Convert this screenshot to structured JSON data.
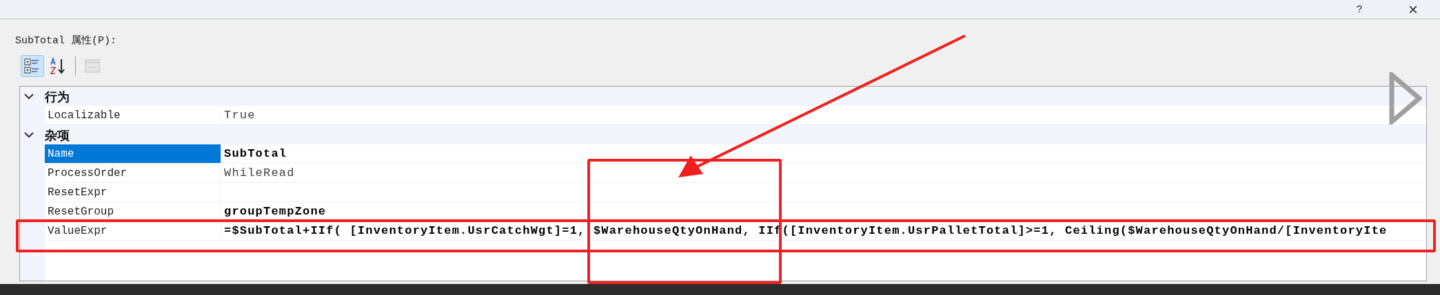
{
  "title_bar": {
    "buttons": [
      "?",
      "×"
    ]
  },
  "header": {
    "label": "SubTotal 属性(P):"
  },
  "toolbar": [
    {
      "kind": "categorized",
      "selected": true,
      "disabled": false
    },
    {
      "kind": "alphabetical",
      "selected": false,
      "disabled": false
    },
    {
      "kind": "pages",
      "selected": false,
      "disabled": true
    }
  ],
  "grid": {
    "categories": [
      {
        "name": "行为",
        "expanded": true,
        "properties": [
          {
            "name": "Localizable",
            "value": "True",
            "bold": false,
            "selected": false
          }
        ]
      },
      {
        "name": "杂项",
        "expanded": true,
        "properties": [
          {
            "name": "Name",
            "value": "SubTotal",
            "bold": true,
            "selected": true
          },
          {
            "name": "ProcessOrder",
            "value": "WhileRead",
            "bold": false,
            "selected": false
          },
          {
            "name": "ResetExpr",
            "selected": false
          },
          {
            "name": "ResetGroup",
            "value": "groupTempZone",
            "bold": true,
            "selected": false
          },
          {
            "name": "ValueExpr",
            "value": "=$SubTotal+IIf( [InventoryItem.UsrCatchWgt]=1, $WarehouseQtyOnHand, IIf([InventoryItem.UsrPalletTotal]>=1, Ceiling($WarehouseQtyOnHand/[InventoryIte",
            "bold": true,
            "selected": false
          }
        ]
      }
    ]
  }
}
